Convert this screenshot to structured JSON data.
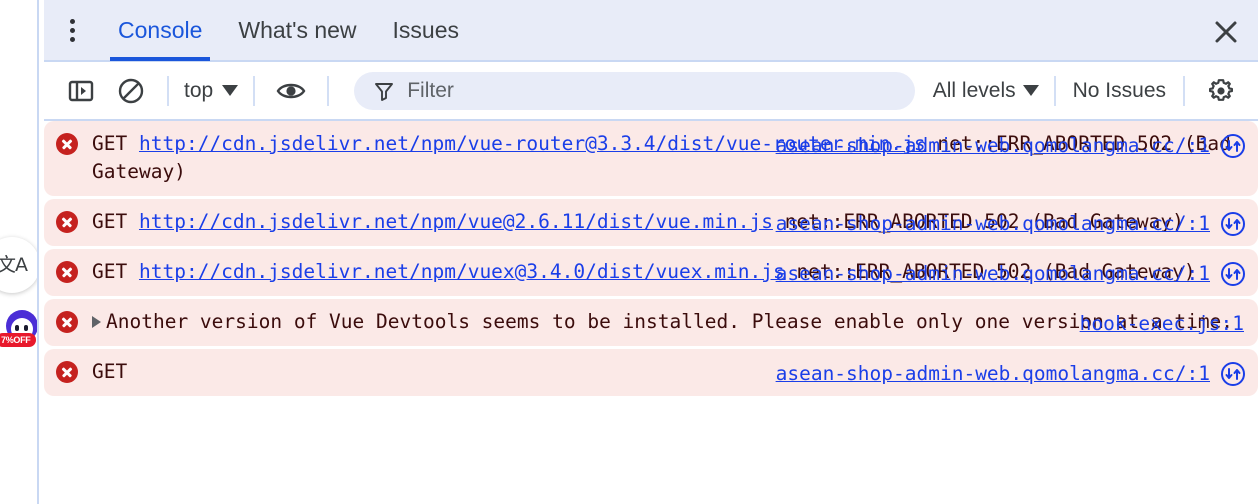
{
  "page_widgets": {
    "translate": {
      "name": "translate-widget",
      "glyph": "文A"
    },
    "promo": {
      "name": "promo-widget",
      "badge": "7%OFF"
    }
  },
  "devtools": {
    "tabbar": {
      "more_label": "more-options",
      "tabs": [
        {
          "id": "console",
          "label": "Console",
          "active": true
        },
        {
          "id": "whats-new",
          "label": "What's new",
          "active": false
        },
        {
          "id": "issues",
          "label": "Issues",
          "active": false
        }
      ],
      "close_label": "Close DevTools",
      "active_color": "#1a56db",
      "background": "#e8ecf8"
    },
    "toolbar": {
      "sidebar_toggle_label": "Show console sidebar",
      "clear_label": "Clear console",
      "context": {
        "value": "top",
        "label": "JavaScript context"
      },
      "eye_label": "Create live expression",
      "filter": {
        "placeholder": "Filter",
        "value": ""
      },
      "levels": {
        "value": "All levels"
      },
      "issues": {
        "label": "No Issues"
      },
      "settings_label": "Console settings"
    },
    "console": {
      "messages": [
        {
          "level": "error",
          "method": "GET",
          "url": "http://cdn.jsdelivr.net/npm/vue-router@3.3.4/dist/vue-router.min.js",
          "tail": "net::ERR_ABORTED 502 (Bad Gateway)",
          "source": "asean-shop-admin-web.qomolangma.cc/:1",
          "has_jump": true
        },
        {
          "level": "error",
          "method": "GET",
          "url": "http://cdn.jsdelivr.net/npm/vue@2.6.11/dist/vue.min.js",
          "tail": "net::ERR_ABORTED 502 (Bad Gateway)",
          "source": "asean-shop-admin-web.qomolangma.cc/:1",
          "has_jump": true
        },
        {
          "level": "error",
          "method": "GET",
          "url": "http://cdn.jsdelivr.net/npm/vuex@3.4.0/dist/vuex.min.js",
          "tail": "net::ERR_ABORTED 502 (Bad Gateway)",
          "source": "asean-shop-admin-web.qomolangma.cc/:1",
          "has_jump": true
        },
        {
          "level": "error",
          "expandable": true,
          "text": "Another version of Vue Devtools seems to be installed. Please enable only one version at a time.",
          "source": "hook-exec.js:1",
          "has_jump": false
        },
        {
          "level": "error",
          "method": "GET",
          "url": "",
          "tail": "",
          "source": "asean-shop-admin-web.qomolangma.cc/:1",
          "has_jump": true
        }
      ],
      "colors": {
        "error_background": "#fbe9e7",
        "error_icon": "#c5221f",
        "link": "#1a3ee8",
        "text": "#3b0c0c"
      }
    }
  }
}
